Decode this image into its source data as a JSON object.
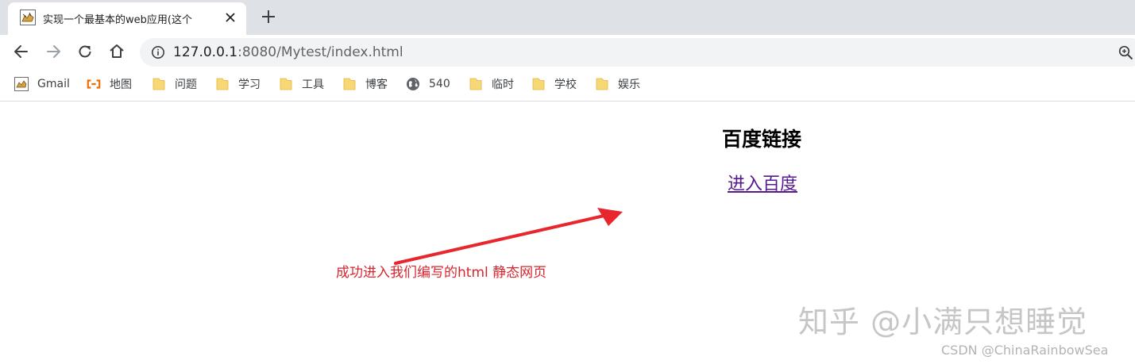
{
  "tab": {
    "title": "实现一个最基本的web应用(这个",
    "favicon": "tomcat-logo-icon",
    "close_icon": "close-icon"
  },
  "new_tab_icon": "plus-icon",
  "toolbar": {
    "back_icon": "back-arrow-icon",
    "forward_icon": "forward-arrow-icon",
    "reload_icon": "reload-icon",
    "home_icon": "home-icon",
    "site_info_icon": "info-icon",
    "url_host": "127.0.0.1",
    "url_rest": ":8080/Mytest/index.html",
    "zoom_icon": "zoom-icon"
  },
  "bookmarks": [
    {
      "label": "Gmail",
      "icon": "gmail-icon"
    },
    {
      "label": "地图",
      "icon": "map-icon"
    },
    {
      "label": "问题",
      "icon": "folder-icon"
    },
    {
      "label": "学习",
      "icon": "folder-icon"
    },
    {
      "label": "工具",
      "icon": "folder-icon"
    },
    {
      "label": "博客",
      "icon": "folder-icon"
    },
    {
      "label": "540",
      "icon": "globe-icon"
    },
    {
      "label": "临时",
      "icon": "folder-icon"
    },
    {
      "label": "学校",
      "icon": "folder-icon"
    },
    {
      "label": "娱乐",
      "icon": "folder-icon"
    }
  ],
  "page": {
    "heading": "百度链接",
    "link_text": "进入百度"
  },
  "annotation": {
    "text": "成功进入我们编写的html 静态网页",
    "color": "#d7252d"
  },
  "watermarks": {
    "zhihu": "知乎 @小满只想睡觉",
    "csdn": "CSDN @ChinaRainbowSea"
  },
  "colors": {
    "tab_strip": "#dee1e6",
    "omnibox": "#f1f3f4",
    "folder": "#f8d775",
    "visited_link": "#551a8b"
  }
}
